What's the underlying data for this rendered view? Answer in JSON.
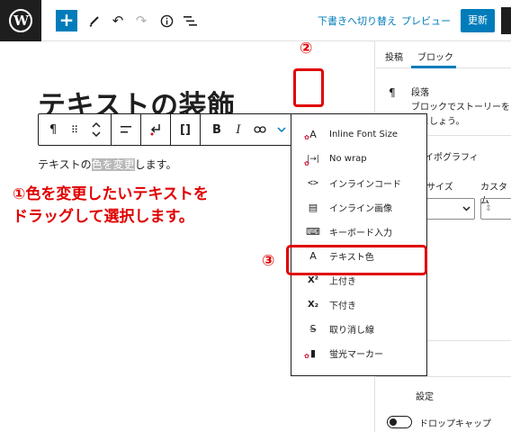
{
  "header": {
    "logo_text": "W",
    "add_label": "+",
    "icons": [
      "pen-icon",
      "undo-icon",
      "redo-icon",
      "info-icon",
      "list-view-icon"
    ],
    "switch_to_draft": "下書きへ切り替え",
    "preview": "プレビュー",
    "update": "更新"
  },
  "editor": {
    "heading": "テキストの装飾",
    "paragraph_before": "テキストの",
    "paragraph_selected": "色を変更",
    "paragraph_after": "します。",
    "toolbar": {
      "paragraph": "¶",
      "drag": "⠿",
      "updown": "⌃",
      "align": "☰",
      "bold": "B",
      "italic": "I",
      "link": "⛓",
      "more": "⌄",
      "options": "⋮"
    }
  },
  "annotations": {
    "step1_line1": "①色を変更したいテキストを",
    "step1_line2": "ドラッグして選択します。",
    "step2": "②",
    "step3": "③"
  },
  "format_menu": {
    "items": [
      {
        "label": "Inline Font Size",
        "icon": "A"
      },
      {
        "label": "No wrap",
        "icon": "|→|"
      },
      {
        "label": "インラインコード",
        "icon": "<>"
      },
      {
        "label": "インライン画像",
        "icon": "▤"
      },
      {
        "label": "キーボード入力",
        "icon": "⌨"
      },
      {
        "label": "テキスト色",
        "icon": "A"
      },
      {
        "label": "上付き",
        "icon": "X²"
      },
      {
        "label": "下付き",
        "icon": "X₂"
      },
      {
        "label": "取り消し線",
        "icon": "S̶"
      },
      {
        "label": "蛍光マーカー",
        "icon": "▮"
      }
    ]
  },
  "sidebar": {
    "tabs": [
      "投稿",
      "ブロック"
    ],
    "block_title": "段落",
    "block_desc_line1": "ブロックでストーリーを",
    "block_desc_line2": "みましょう。",
    "typography": "タイポグラフィ",
    "size": "サイズ",
    "custom": "カスタム",
    "settings": "設定",
    "drop_cap": "ドロップキャップ"
  },
  "colors": {
    "accent": "#007cba",
    "annotation": "#e00000",
    "dark": "#1e1e1e"
  }
}
